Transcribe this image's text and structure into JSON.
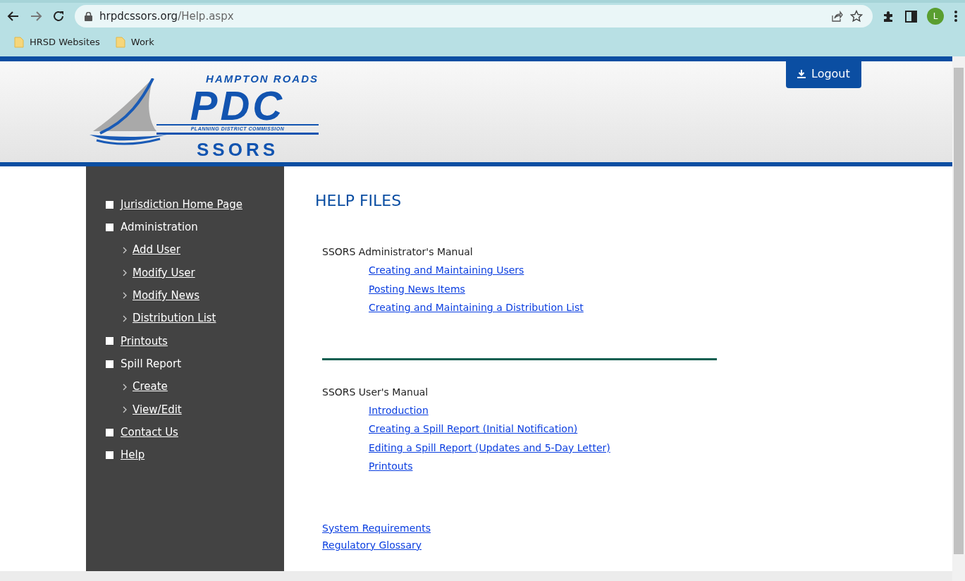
{
  "browser": {
    "url_host": "hrpdcssors.org",
    "url_path": "/Help.aspx",
    "profile_initial": "L",
    "bookmarks": [
      "HRSD Websites",
      "Work"
    ]
  },
  "header": {
    "logo": {
      "top_line": "HAMPTON ROADS",
      "main": "PDC",
      "sub_line": "PLANNING DISTRICT COMMISSION",
      "product": "SSORS"
    },
    "logout_label": "Logout"
  },
  "sidebar": {
    "items": [
      {
        "label": "Jurisdiction Home Page",
        "kind": "link"
      },
      {
        "label": "Administration",
        "kind": "label",
        "children": [
          {
            "label": "Add User",
            "kind": "link"
          },
          {
            "label": "Modify User",
            "kind": "link"
          },
          {
            "label": "Modify News",
            "kind": "link"
          },
          {
            "label": "Distribution List",
            "kind": "link"
          }
        ]
      },
      {
        "label": "Printouts",
        "kind": "link"
      },
      {
        "label": "Spill Report",
        "kind": "label",
        "children": [
          {
            "label": "Create",
            "kind": "link"
          },
          {
            "label": "View/Edit",
            "kind": "link"
          }
        ]
      },
      {
        "label": "Contact Us",
        "kind": "link"
      },
      {
        "label": "Help",
        "kind": "link"
      }
    ]
  },
  "content": {
    "title": "HELP FILES",
    "sections": [
      {
        "heading": "SSORS Administrator's Manual",
        "links": [
          "Creating and Maintaining Users",
          "Posting News Items",
          "Creating and Maintaining a Distribution List"
        ]
      },
      {
        "heading": "SSORS User's Manual",
        "links": [
          "Introduction",
          "Creating a Spill Report (Initial Notification)",
          "Editing a Spill Report (Updates and 5-Day Letter)",
          "Printouts"
        ]
      }
    ],
    "footer_links": [
      "System Requirements",
      "Regulatory Glossary"
    ]
  }
}
